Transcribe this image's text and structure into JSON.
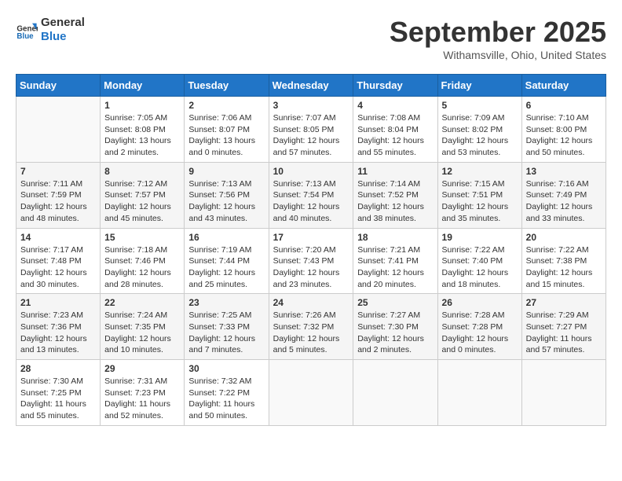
{
  "logo": {
    "line1": "General",
    "line2": "Blue"
  },
  "title": "September 2025",
  "location": "Withamsville, Ohio, United States",
  "weekdays": [
    "Sunday",
    "Monday",
    "Tuesday",
    "Wednesday",
    "Thursday",
    "Friday",
    "Saturday"
  ],
  "days": [
    {
      "num": "",
      "sunrise": "",
      "sunset": "",
      "daylight": ""
    },
    {
      "num": "1",
      "sunrise": "Sunrise: 7:05 AM",
      "sunset": "Sunset: 8:08 PM",
      "daylight": "Daylight: 13 hours and 2 minutes."
    },
    {
      "num": "2",
      "sunrise": "Sunrise: 7:06 AM",
      "sunset": "Sunset: 8:07 PM",
      "daylight": "Daylight: 13 hours and 0 minutes."
    },
    {
      "num": "3",
      "sunrise": "Sunrise: 7:07 AM",
      "sunset": "Sunset: 8:05 PM",
      "daylight": "Daylight: 12 hours and 57 minutes."
    },
    {
      "num": "4",
      "sunrise": "Sunrise: 7:08 AM",
      "sunset": "Sunset: 8:04 PM",
      "daylight": "Daylight: 12 hours and 55 minutes."
    },
    {
      "num": "5",
      "sunrise": "Sunrise: 7:09 AM",
      "sunset": "Sunset: 8:02 PM",
      "daylight": "Daylight: 12 hours and 53 minutes."
    },
    {
      "num": "6",
      "sunrise": "Sunrise: 7:10 AM",
      "sunset": "Sunset: 8:00 PM",
      "daylight": "Daylight: 12 hours and 50 minutes."
    },
    {
      "num": "7",
      "sunrise": "Sunrise: 7:11 AM",
      "sunset": "Sunset: 7:59 PM",
      "daylight": "Daylight: 12 hours and 48 minutes."
    },
    {
      "num": "8",
      "sunrise": "Sunrise: 7:12 AM",
      "sunset": "Sunset: 7:57 PM",
      "daylight": "Daylight: 12 hours and 45 minutes."
    },
    {
      "num": "9",
      "sunrise": "Sunrise: 7:13 AM",
      "sunset": "Sunset: 7:56 PM",
      "daylight": "Daylight: 12 hours and 43 minutes."
    },
    {
      "num": "10",
      "sunrise": "Sunrise: 7:13 AM",
      "sunset": "Sunset: 7:54 PM",
      "daylight": "Daylight: 12 hours and 40 minutes."
    },
    {
      "num": "11",
      "sunrise": "Sunrise: 7:14 AM",
      "sunset": "Sunset: 7:52 PM",
      "daylight": "Daylight: 12 hours and 38 minutes."
    },
    {
      "num": "12",
      "sunrise": "Sunrise: 7:15 AM",
      "sunset": "Sunset: 7:51 PM",
      "daylight": "Daylight: 12 hours and 35 minutes."
    },
    {
      "num": "13",
      "sunrise": "Sunrise: 7:16 AM",
      "sunset": "Sunset: 7:49 PM",
      "daylight": "Daylight: 12 hours and 33 minutes."
    },
    {
      "num": "14",
      "sunrise": "Sunrise: 7:17 AM",
      "sunset": "Sunset: 7:48 PM",
      "daylight": "Daylight: 12 hours and 30 minutes."
    },
    {
      "num": "15",
      "sunrise": "Sunrise: 7:18 AM",
      "sunset": "Sunset: 7:46 PM",
      "daylight": "Daylight: 12 hours and 28 minutes."
    },
    {
      "num": "16",
      "sunrise": "Sunrise: 7:19 AM",
      "sunset": "Sunset: 7:44 PM",
      "daylight": "Daylight: 12 hours and 25 minutes."
    },
    {
      "num": "17",
      "sunrise": "Sunrise: 7:20 AM",
      "sunset": "Sunset: 7:43 PM",
      "daylight": "Daylight: 12 hours and 23 minutes."
    },
    {
      "num": "18",
      "sunrise": "Sunrise: 7:21 AM",
      "sunset": "Sunset: 7:41 PM",
      "daylight": "Daylight: 12 hours and 20 minutes."
    },
    {
      "num": "19",
      "sunrise": "Sunrise: 7:22 AM",
      "sunset": "Sunset: 7:40 PM",
      "daylight": "Daylight: 12 hours and 18 minutes."
    },
    {
      "num": "20",
      "sunrise": "Sunrise: 7:22 AM",
      "sunset": "Sunset: 7:38 PM",
      "daylight": "Daylight: 12 hours and 15 minutes."
    },
    {
      "num": "21",
      "sunrise": "Sunrise: 7:23 AM",
      "sunset": "Sunset: 7:36 PM",
      "daylight": "Daylight: 12 hours and 13 minutes."
    },
    {
      "num": "22",
      "sunrise": "Sunrise: 7:24 AM",
      "sunset": "Sunset: 7:35 PM",
      "daylight": "Daylight: 12 hours and 10 minutes."
    },
    {
      "num": "23",
      "sunrise": "Sunrise: 7:25 AM",
      "sunset": "Sunset: 7:33 PM",
      "daylight": "Daylight: 12 hours and 7 minutes."
    },
    {
      "num": "24",
      "sunrise": "Sunrise: 7:26 AM",
      "sunset": "Sunset: 7:32 PM",
      "daylight": "Daylight: 12 hours and 5 minutes."
    },
    {
      "num": "25",
      "sunrise": "Sunrise: 7:27 AM",
      "sunset": "Sunset: 7:30 PM",
      "daylight": "Daylight: 12 hours and 2 minutes."
    },
    {
      "num": "26",
      "sunrise": "Sunrise: 7:28 AM",
      "sunset": "Sunset: 7:28 PM",
      "daylight": "Daylight: 12 hours and 0 minutes."
    },
    {
      "num": "27",
      "sunrise": "Sunrise: 7:29 AM",
      "sunset": "Sunset: 7:27 PM",
      "daylight": "Daylight: 11 hours and 57 minutes."
    },
    {
      "num": "28",
      "sunrise": "Sunrise: 7:30 AM",
      "sunset": "Sunset: 7:25 PM",
      "daylight": "Daylight: 11 hours and 55 minutes."
    },
    {
      "num": "29",
      "sunrise": "Sunrise: 7:31 AM",
      "sunset": "Sunset: 7:23 PM",
      "daylight": "Daylight: 11 hours and 52 minutes."
    },
    {
      "num": "30",
      "sunrise": "Sunrise: 7:32 AM",
      "sunset": "Sunset: 7:22 PM",
      "daylight": "Daylight: 11 hours and 50 minutes."
    }
  ]
}
